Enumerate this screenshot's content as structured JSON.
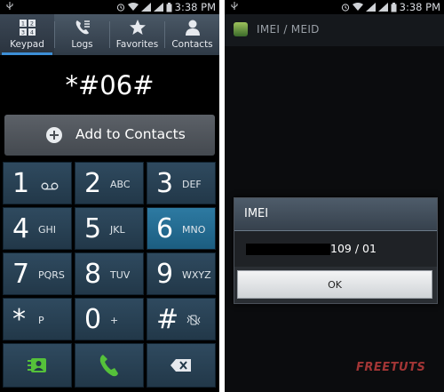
{
  "left_screen": {
    "status_time": "3:38 PM",
    "tabs": [
      {
        "label": "Keypad",
        "icon": "keypad-icon"
      },
      {
        "label": "Logs",
        "icon": "call-log-icon"
      },
      {
        "label": "Favorites",
        "icon": "star-icon"
      },
      {
        "label": "Contacts",
        "icon": "person-icon"
      }
    ],
    "active_tab": "Keypad",
    "dialed_number": "*#06#",
    "add_to_contacts_label": "Add to Contacts",
    "keys": [
      {
        "digit": "1",
        "letters": "oo"
      },
      {
        "digit": "2",
        "letters": "ABC"
      },
      {
        "digit": "3",
        "letters": "DEF"
      },
      {
        "digit": "4",
        "letters": "GHI"
      },
      {
        "digit": "5",
        "letters": "JKL"
      },
      {
        "digit": "6",
        "letters": "MNO"
      },
      {
        "digit": "7",
        "letters": "PQRS"
      },
      {
        "digit": "8",
        "letters": "TUV"
      },
      {
        "digit": "9",
        "letters": "WXYZ"
      },
      {
        "digit": "*",
        "letters": "P"
      },
      {
        "digit": "0",
        "letters": "+"
      },
      {
        "digit": "#",
        "letters": ""
      }
    ],
    "highlighted_key": "6",
    "action_icons": [
      "contact-card-icon",
      "phone-call-icon",
      "backspace-icon"
    ]
  },
  "right_screen": {
    "status_time": "3:38 PM",
    "app_title": "IMEI / MEID",
    "dialog": {
      "title": "IMEI",
      "value_suffix": "109 / 01",
      "ok_label": "OK"
    },
    "watermark": "FREETUTS"
  },
  "colors": {
    "accent_blue": "#3d8fd6",
    "key_bg": "#2f4a5f",
    "key_highlight": "#2d7aa2",
    "call_green": "#55c13a"
  }
}
